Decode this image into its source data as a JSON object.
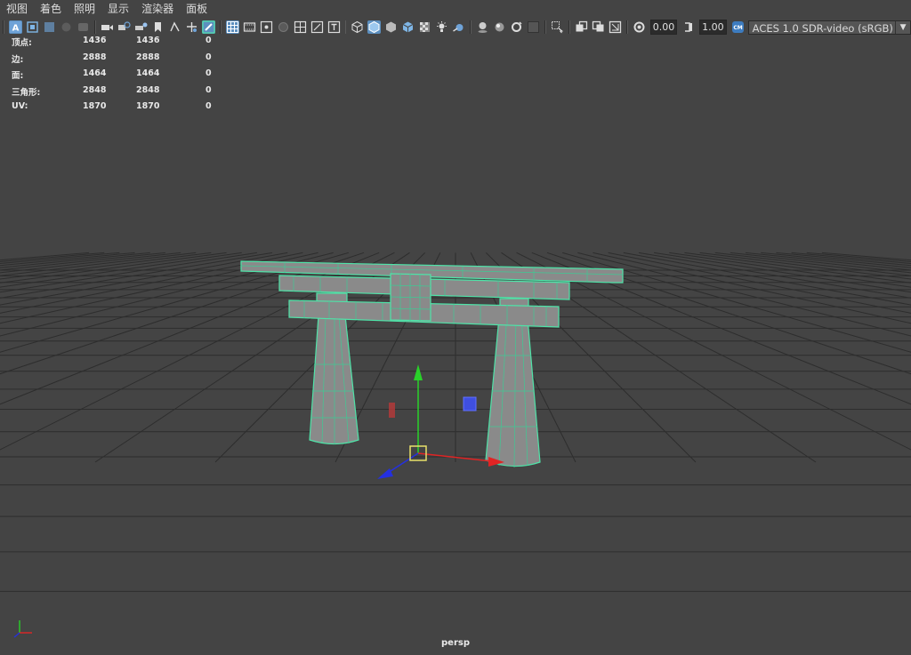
{
  "menu": [
    "视图",
    "着色",
    "照明",
    "显示",
    "渲染器",
    "面板"
  ],
  "toolbar": {
    "exposure": "0.00",
    "gamma": "1.00",
    "colorspace": "ACES 1.0 SDR-video (sRGB)",
    "icons": [
      "select-camera-icon",
      "camera-attributes-icon",
      "bookmarks-icon",
      "image-plane-icon",
      "2d-pan-zoom-icon",
      "grease-pencil-icon",
      "grid-icon",
      "film-gate-icon",
      "resolution-gate-icon",
      "gate-mask-icon",
      "field-chart-icon",
      "safe-action-icon",
      "safe-title-icon",
      "wireframe-icon",
      "smooth-shade-icon",
      "bounding-box-icon",
      "textured-icon",
      "use-all-lights-icon",
      "shadows-icon",
      "screen-space-ao-icon",
      "motion-blur-icon",
      "anti-aliasing-icon",
      "depth-of-field-icon",
      "isolate-select-icon",
      "xray-icon",
      "xray-active-icon",
      "xray-joints-icon",
      "exposure-icon",
      "gamma-icon",
      "view-transform-icon"
    ]
  },
  "hud": {
    "rows": [
      {
        "label": "顶点:",
        "v1": "1436",
        "v2": "1436",
        "v3": "0"
      },
      {
        "label": "边:",
        "v1": "2888",
        "v2": "2888",
        "v3": "0"
      },
      {
        "label": "面:",
        "v1": "1464",
        "v2": "1464",
        "v3": "0"
      },
      {
        "label": "三角形:",
        "v1": "2848",
        "v2": "2848",
        "v3": "0"
      },
      {
        "label": "UV:",
        "v1": "1870",
        "v2": "1870",
        "v3": "0"
      }
    ]
  },
  "viewport": {
    "camera": "persp",
    "wire_color": "#4fe3a8",
    "grid_color": "#2d2d2d",
    "background": "#444444"
  }
}
